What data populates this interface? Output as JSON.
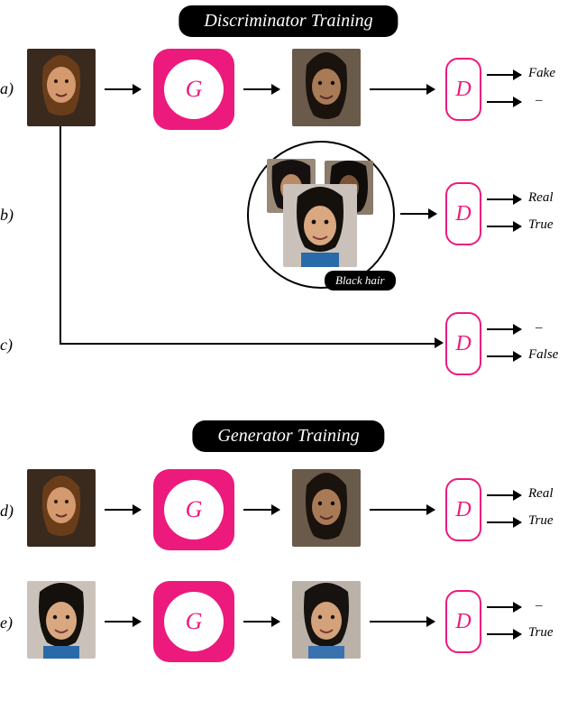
{
  "headers": {
    "discriminator": "Discriminator Training",
    "generator": "Generator Training"
  },
  "rows": {
    "a": "a)",
    "b": "b)",
    "c": "c)",
    "d": "d)",
    "e": "e)"
  },
  "blocks": {
    "G": "G",
    "D": "D"
  },
  "pill": {
    "black_hair": "Black hair"
  },
  "outputs": {
    "a": {
      "top": "Fake",
      "bot": "–"
    },
    "b": {
      "top": "Real",
      "bot": "True"
    },
    "c": {
      "top": "–",
      "bot": "False"
    },
    "d": {
      "top": "Real",
      "bot": "True"
    },
    "e": {
      "top": "–",
      "bot": "True"
    }
  },
  "chart_data": {
    "type": "diagram",
    "title": "GAN training flows",
    "phases": [
      {
        "name": "Discriminator Training",
        "flows": [
          {
            "id": "a",
            "input": "source face (brown hair)",
            "through": [
              "G"
            ],
            "intermediate": "generated face (black hair)",
            "discriminator_output": {
              "realness": "Fake",
              "attribute": "–"
            }
          },
          {
            "id": "b",
            "input": "real black-hair face set",
            "through": [],
            "discriminator_output": {
              "realness": "Real",
              "attribute": "True"
            }
          },
          {
            "id": "c",
            "input": "source face (brown hair)",
            "through": [],
            "discriminator_output": {
              "realness": "–",
              "attribute": "False"
            }
          }
        ]
      },
      {
        "name": "Generator Training",
        "flows": [
          {
            "id": "d",
            "input": "source face (brown hair)",
            "through": [
              "G"
            ],
            "intermediate": "generated face (black hair)",
            "discriminator_output": {
              "realness": "Real",
              "attribute": "True"
            }
          },
          {
            "id": "e",
            "input": "real black-hair face",
            "through": [
              "G"
            ],
            "intermediate": "generated face (black hair)",
            "discriminator_output": {
              "realness": "–",
              "attribute": "True"
            }
          }
        ]
      }
    ],
    "attribute_label": "Black hair"
  }
}
